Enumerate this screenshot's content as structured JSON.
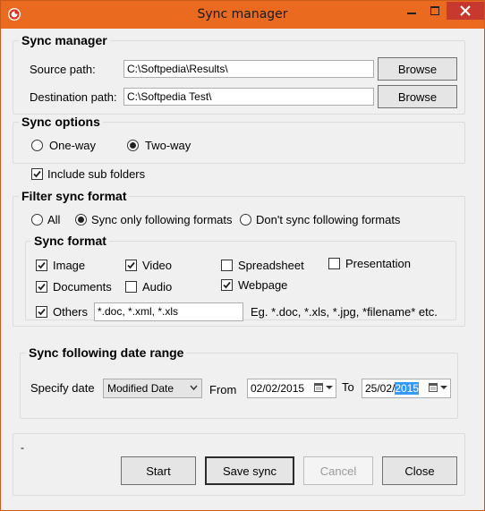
{
  "window": {
    "title": "Sync manager"
  },
  "sync_manager": {
    "legend": "Sync manager",
    "source_label": "Source path:",
    "source_value": "C:\\Softpedia\\Results\\",
    "dest_label": "Destination path:",
    "dest_value": "C:\\Softpedia Test\\",
    "browse_label": "Browse"
  },
  "sync_options": {
    "legend": "Sync options",
    "one_way": "One-way",
    "two_way": "Two-way",
    "selected": "Two-way"
  },
  "include_sub_folders": {
    "label": "Include sub folders",
    "checked": true
  },
  "filter": {
    "legend": "Filter sync format",
    "all": "All",
    "only": "Sync only following formats",
    "dont": "Don't sync following formats",
    "selected": "Sync only following formats"
  },
  "sync_format": {
    "legend": "Sync format",
    "image": {
      "label": "Image",
      "checked": true
    },
    "video": {
      "label": "Video",
      "checked": true
    },
    "spreadsheet": {
      "label": "Spreadsheet",
      "checked": false
    },
    "presentation": {
      "label": "Presentation",
      "checked": false
    },
    "documents": {
      "label": "Documents",
      "checked": true
    },
    "audio": {
      "label": "Audio",
      "checked": false
    },
    "webpage": {
      "label": "Webpage",
      "checked": true
    },
    "others": {
      "label": "Others",
      "checked": true
    },
    "others_value": "*.doc, *.xml, *.xls",
    "example": "Eg. *.doc, *.xls, *.jpg, *filename* etc."
  },
  "date_range": {
    "legend": "Sync following date range",
    "specify_label": "Specify date",
    "specify_value": "Modified Date",
    "from_label": "From",
    "from_value": "02/02/2015",
    "to_label": "To",
    "to_value_prefix": "25/02/",
    "to_value_selected": "2015"
  },
  "status": "-",
  "buttons": {
    "start": "Start",
    "save_sync": "Save sync",
    "cancel": "Cancel",
    "close": "Close"
  },
  "colors": {
    "titlebar": "#ea6a1f",
    "close": "#c7392e",
    "selection": "#3399ff"
  }
}
